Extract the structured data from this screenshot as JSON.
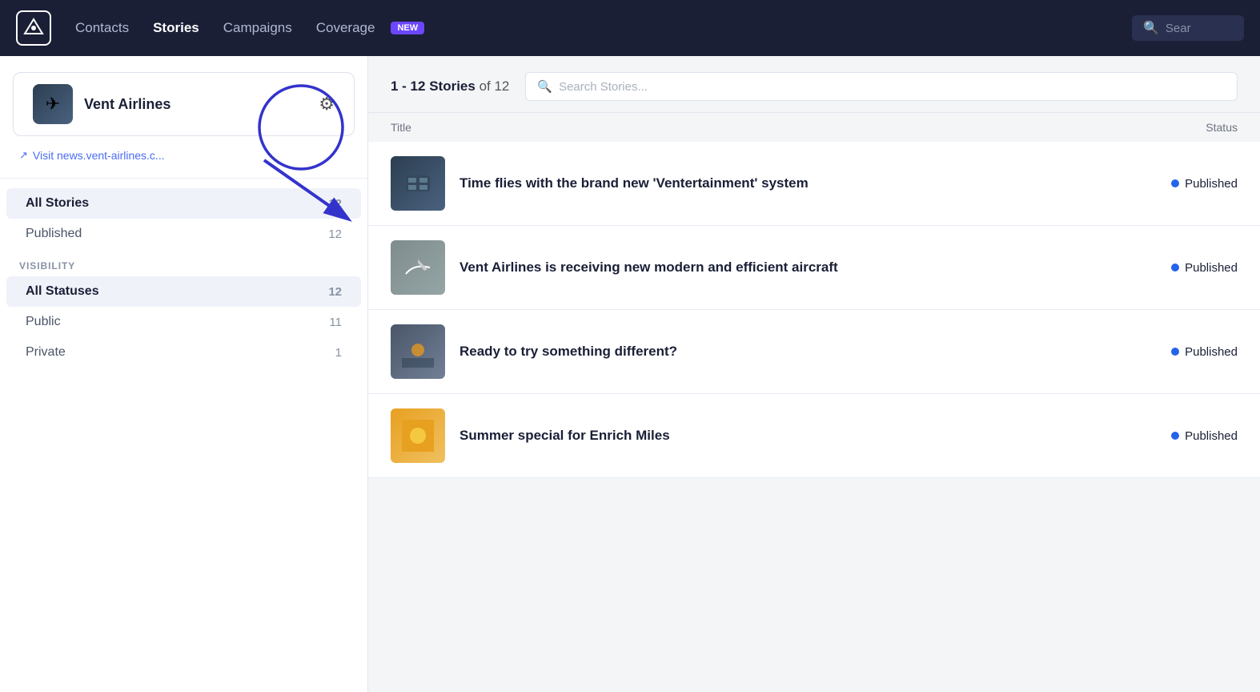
{
  "navbar": {
    "logo_icon": "✉",
    "links": [
      {
        "label": "Contacts",
        "active": false
      },
      {
        "label": "Stories",
        "active": true
      },
      {
        "label": "Campaigns",
        "active": false
      },
      {
        "label": "Coverage",
        "active": false
      }
    ],
    "badge_label": "NEW",
    "search_text": "Sear"
  },
  "sidebar": {
    "org_name": "Vent Airlines",
    "org_logo_icon": "✈",
    "visit_link": "Visit news.vent-airlines.c...",
    "filters": [
      {
        "label": "All Stories",
        "count": "12",
        "active": true
      },
      {
        "label": "Published",
        "count": "12",
        "active": false
      }
    ],
    "visibility_title": "VISIBILITY",
    "visibility_filters": [
      {
        "label": "All Statuses",
        "count": "12",
        "active": true
      },
      {
        "label": "Public",
        "count": "11",
        "active": false
      },
      {
        "label": "Private",
        "count": "1",
        "active": false
      }
    ]
  },
  "content": {
    "stories_range": "1 - 12 Stories",
    "stories_of": "of 12",
    "search_placeholder": "Search Stories...",
    "col_title": "Title",
    "col_status": "Status",
    "stories": [
      {
        "title": "Time flies with the brand new 'Ventertainment' system",
        "status": "Published",
        "thumb_class": "story-thumb-1",
        "thumb_icon": "💺"
      },
      {
        "title": "Vent Airlines is receiving new modern and efficient aircraft",
        "status": "Published",
        "thumb_class": "story-thumb-2",
        "thumb_icon": "✈"
      },
      {
        "title": "Ready to try something different?",
        "status": "Published",
        "thumb_class": "story-thumb-3",
        "thumb_icon": "🌅"
      },
      {
        "title": "Summer special for Enrich Miles",
        "status": "Published",
        "thumb_class": "story-thumb-4",
        "thumb_icon": "🌞"
      }
    ]
  }
}
